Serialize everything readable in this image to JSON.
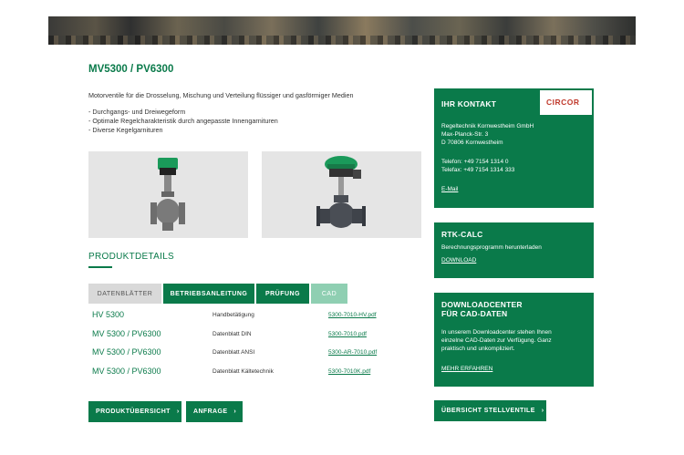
{
  "product": {
    "title": "MV5300 / PV6300",
    "intro": "Motorventile für die Drosselung, Mischung und Verteilung flüssiger und gasförmiger Medien",
    "bullets": [
      "Durchgangs- und Dreiwegeform",
      "Optimale Regelcharakteristik durch angepasste Innengarnituren",
      "Diverse Kegelgarnituren"
    ]
  },
  "details": {
    "title": "PRODUKTDETAILS",
    "tabs": [
      "DATENBLÄTTER",
      "BETRIEBSANLEITUNG",
      "PRÜFUNG",
      "CAD"
    ],
    "rows": [
      {
        "name": "HV 5300",
        "desc": "Handbetätigung",
        "file": "5300-7010-HV.pdf"
      },
      {
        "name": "MV 5300 / PV6300",
        "desc": "Datenblatt DIN",
        "file": "5300-7010.pdf"
      },
      {
        "name": "MV 5300 / PV6300",
        "desc": "Datenblatt ANSI",
        "file": "5300-AR-7010.pdf"
      },
      {
        "name": "MV 5300 / PV6300",
        "desc": "Datenblatt Kältetechnik",
        "file": "5300-7010K.pdf"
      }
    ]
  },
  "buttons": {
    "overview": "PRODUKTÜBERSICHT",
    "inquiry": "ANFRAGE",
    "valves_overview": "ÜBERSICHT STELLVENTILE",
    "arrow": "›"
  },
  "contact": {
    "title": "IHR KONTAKT",
    "logo": "CIRCOR",
    "company": "Regeltechnik Kornwestheim GmbH",
    "street": "Max-Planck-Str. 3",
    "city": "D 70806 Kornwestheim",
    "phone": "Telefon: +49 7154 1314 0",
    "fax": "Telefax: +49 7154 1314 333",
    "email_label": "E-Mail"
  },
  "rtk": {
    "title": "RTK-CALC",
    "text": "Berechnungsprogramm herunterladen",
    "link": "DOWNLOAD"
  },
  "downloads": {
    "title_line1": "DOWNLOADCENTER",
    "title_line2": "FÜR CAD-DATEN",
    "text_line1": "In unserem Downloadcenter stehen Ihnen",
    "text_line2": "einzelne CAD-Daten zur Verfügung. Ganz",
    "text_line3": "praktisch und unkompliziert.",
    "link": "MEHR ERFAHREN"
  },
  "colors": {
    "brand_green": "#0a7a4a",
    "tab_inactive": "#d9d9d9",
    "tab_disabled": "#8fcfb2",
    "logo_red": "#c0392b"
  }
}
